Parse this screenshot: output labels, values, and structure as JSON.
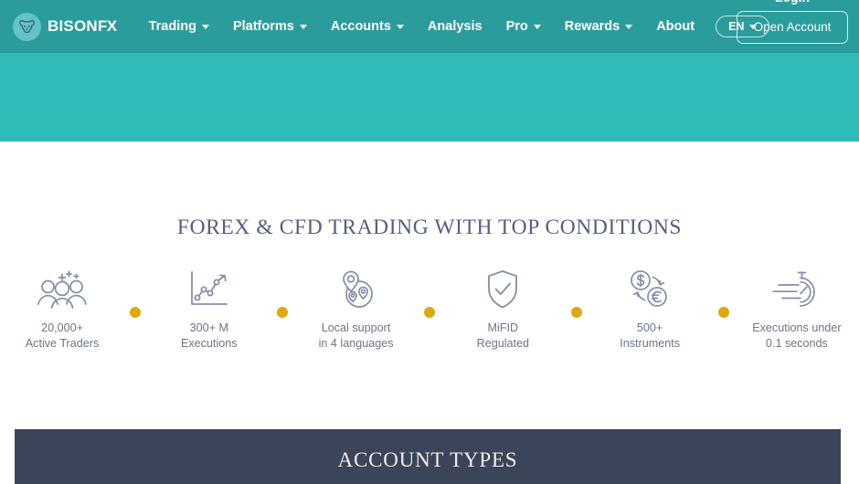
{
  "header": {
    "brand": {
      "name_primary": "BISON",
      "name_secondary": "FX",
      "logo_icon": "bison-head-icon"
    },
    "nav": [
      {
        "label": "Trading",
        "has_dropdown": true
      },
      {
        "label": "Platforms",
        "has_dropdown": true
      },
      {
        "label": "Accounts",
        "has_dropdown": true
      },
      {
        "label": "Analysis",
        "has_dropdown": false
      },
      {
        "label": "Pro",
        "has_dropdown": true
      },
      {
        "label": "Rewards",
        "has_dropdown": true
      },
      {
        "label": "About",
        "has_dropdown": false
      }
    ],
    "language": {
      "label": "EN",
      "icon": "chevron-down-icon"
    },
    "login_label": "Login",
    "open_account_label": "Open Account",
    "bar_color": "#2b9c9c",
    "hero_color": "#2fbcb9"
  },
  "features_section": {
    "title": "FOREX & CFD TRADING WITH TOP CONDITIONS",
    "title_color": "#565f7e",
    "separator_color": "#e0a810",
    "items": [
      {
        "icon": "people-group-icon",
        "label": "20,000+\nActive Traders"
      },
      {
        "icon": "growth-chart-icon",
        "label": "300+ M\nExecutions"
      },
      {
        "icon": "map-pins-icon",
        "label": "Local support\nin 4 languages"
      },
      {
        "icon": "shield-check-icon",
        "label": "MiFID\nRegulated"
      },
      {
        "icon": "currency-exchange-icon",
        "label": "500+\nInstruments"
      },
      {
        "icon": "stopwatch-speed-icon",
        "label": "Executions under\n0.1 seconds"
      }
    ]
  },
  "account_types_section": {
    "title": "ACCOUNT TYPES",
    "background_color": "#3c4459"
  }
}
